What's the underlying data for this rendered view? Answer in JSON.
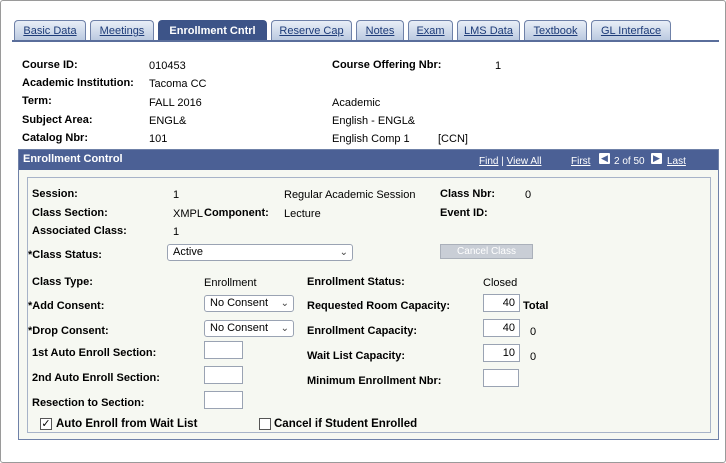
{
  "tabs": [
    {
      "label": "Basic Data"
    },
    {
      "label": "Meetings"
    },
    {
      "label": "Enrollment Cntrl"
    },
    {
      "label": "Reserve Cap"
    },
    {
      "label": "Notes"
    },
    {
      "label": "Exam"
    },
    {
      "label": "LMS Data"
    },
    {
      "label": "Textbook"
    },
    {
      "label": "GL Interface"
    }
  ],
  "header": {
    "course_id_label": "Course ID:",
    "course_id": "010453",
    "offering_label": "Course Offering Nbr:",
    "offering": "1",
    "institution_label": "Academic Institution:",
    "institution": "Tacoma CC",
    "term_label": "Term:",
    "term": "FALL 2016",
    "term_desc": "Academic",
    "subject_label": "Subject Area:",
    "subject": "ENGL&",
    "subject_desc": "English - ENGL&",
    "catalog_label": "Catalog Nbr:",
    "catalog": "101",
    "catalog_desc": "English Comp 1",
    "catalog_flag": "[CCN]"
  },
  "panel": {
    "title": "Enrollment Control",
    "find": "Find",
    "sep": "|",
    "view_all": "View All",
    "first": "First",
    "prev_icon": "chevron-left-icon",
    "page_info": "2 of 50",
    "next_icon": "chevron-right-icon",
    "last": "Last"
  },
  "enroll": {
    "session_label": "Session:",
    "session": "1",
    "session_desc": "Regular Academic Session",
    "class_nbr_label": "Class Nbr:",
    "class_nbr": "0",
    "section_label": "Class Section:",
    "section": "XMPL",
    "component_label": "Component:",
    "component": "Lecture",
    "event_label": "Event ID:",
    "assoc_label": "Associated Class:",
    "assoc": "1",
    "status_label": "*Class Status:",
    "status": "Active",
    "cancel_button": "Cancel Class",
    "class_type_label": "Class Type:",
    "class_type": "Enrollment",
    "enroll_status_label": "Enrollment Status:",
    "enroll_status": "Closed",
    "add_consent_label": "*Add Consent:",
    "add_consent": "No Consent",
    "room_cap_label": "Requested Room Capacity:",
    "room_cap": "40",
    "total_label": "Total",
    "drop_consent_label": "*Drop Consent:",
    "drop_consent": "No Consent",
    "enroll_cap_label": "Enrollment Capacity:",
    "enroll_cap": "40",
    "enroll_total": "0",
    "auto1_label": "1st Auto Enroll Section:",
    "auto1": "",
    "wait_cap_label": "Wait List Capacity:",
    "wait_cap": "10",
    "wait_total": "0",
    "auto2_label": "2nd Auto Enroll Section:",
    "auto2": "",
    "min_enroll_label": "Minimum Enrollment Nbr:",
    "min_enroll": "",
    "resection_label": "Resection to Section:",
    "resection": "",
    "auto_wait_label": "Auto Enroll from Wait List",
    "auto_wait_checked": true,
    "cancel_enrolled_label": "Cancel if Student Enrolled",
    "cancel_enrolled_checked": false
  },
  "colors": {
    "tab_active": "#3d5488",
    "panel_header": "#4b6095",
    "panel_bg": "#f6f8f2"
  }
}
